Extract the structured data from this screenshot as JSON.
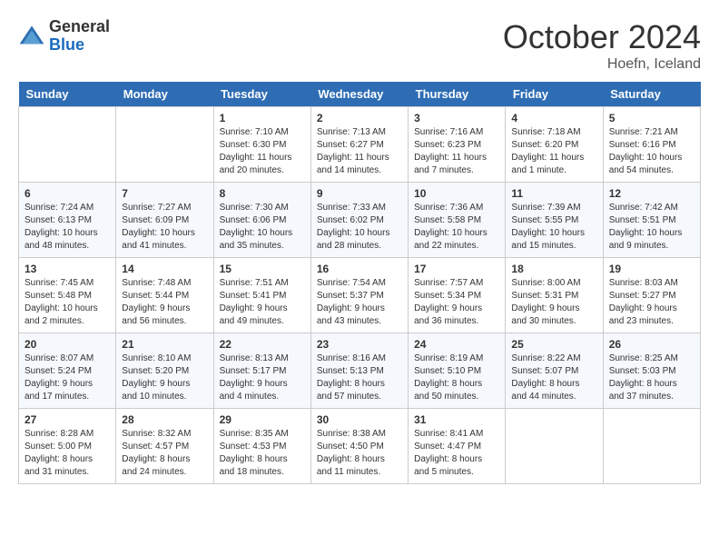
{
  "header": {
    "logo_general": "General",
    "logo_blue": "Blue",
    "month_title": "October 2024",
    "location": "Hoefn, Iceland"
  },
  "days_of_week": [
    "Sunday",
    "Monday",
    "Tuesday",
    "Wednesday",
    "Thursday",
    "Friday",
    "Saturday"
  ],
  "weeks": [
    [
      {
        "day": "",
        "sunrise": "",
        "sunset": "",
        "daylight": ""
      },
      {
        "day": "",
        "sunrise": "",
        "sunset": "",
        "daylight": ""
      },
      {
        "day": "1",
        "sunrise": "Sunrise: 7:10 AM",
        "sunset": "Sunset: 6:30 PM",
        "daylight": "Daylight: 11 hours and 20 minutes."
      },
      {
        "day": "2",
        "sunrise": "Sunrise: 7:13 AM",
        "sunset": "Sunset: 6:27 PM",
        "daylight": "Daylight: 11 hours and 14 minutes."
      },
      {
        "day": "3",
        "sunrise": "Sunrise: 7:16 AM",
        "sunset": "Sunset: 6:23 PM",
        "daylight": "Daylight: 11 hours and 7 minutes."
      },
      {
        "day": "4",
        "sunrise": "Sunrise: 7:18 AM",
        "sunset": "Sunset: 6:20 PM",
        "daylight": "Daylight: 11 hours and 1 minute."
      },
      {
        "day": "5",
        "sunrise": "Sunrise: 7:21 AM",
        "sunset": "Sunset: 6:16 PM",
        "daylight": "Daylight: 10 hours and 54 minutes."
      }
    ],
    [
      {
        "day": "6",
        "sunrise": "Sunrise: 7:24 AM",
        "sunset": "Sunset: 6:13 PM",
        "daylight": "Daylight: 10 hours and 48 minutes."
      },
      {
        "day": "7",
        "sunrise": "Sunrise: 7:27 AM",
        "sunset": "Sunset: 6:09 PM",
        "daylight": "Daylight: 10 hours and 41 minutes."
      },
      {
        "day": "8",
        "sunrise": "Sunrise: 7:30 AM",
        "sunset": "Sunset: 6:06 PM",
        "daylight": "Daylight: 10 hours and 35 minutes."
      },
      {
        "day": "9",
        "sunrise": "Sunrise: 7:33 AM",
        "sunset": "Sunset: 6:02 PM",
        "daylight": "Daylight: 10 hours and 28 minutes."
      },
      {
        "day": "10",
        "sunrise": "Sunrise: 7:36 AM",
        "sunset": "Sunset: 5:58 PM",
        "daylight": "Daylight: 10 hours and 22 minutes."
      },
      {
        "day": "11",
        "sunrise": "Sunrise: 7:39 AM",
        "sunset": "Sunset: 5:55 PM",
        "daylight": "Daylight: 10 hours and 15 minutes."
      },
      {
        "day": "12",
        "sunrise": "Sunrise: 7:42 AM",
        "sunset": "Sunset: 5:51 PM",
        "daylight": "Daylight: 10 hours and 9 minutes."
      }
    ],
    [
      {
        "day": "13",
        "sunrise": "Sunrise: 7:45 AM",
        "sunset": "Sunset: 5:48 PM",
        "daylight": "Daylight: 10 hours and 2 minutes."
      },
      {
        "day": "14",
        "sunrise": "Sunrise: 7:48 AM",
        "sunset": "Sunset: 5:44 PM",
        "daylight": "Daylight: 9 hours and 56 minutes."
      },
      {
        "day": "15",
        "sunrise": "Sunrise: 7:51 AM",
        "sunset": "Sunset: 5:41 PM",
        "daylight": "Daylight: 9 hours and 49 minutes."
      },
      {
        "day": "16",
        "sunrise": "Sunrise: 7:54 AM",
        "sunset": "Sunset: 5:37 PM",
        "daylight": "Daylight: 9 hours and 43 minutes."
      },
      {
        "day": "17",
        "sunrise": "Sunrise: 7:57 AM",
        "sunset": "Sunset: 5:34 PM",
        "daylight": "Daylight: 9 hours and 36 minutes."
      },
      {
        "day": "18",
        "sunrise": "Sunrise: 8:00 AM",
        "sunset": "Sunset: 5:31 PM",
        "daylight": "Daylight: 9 hours and 30 minutes."
      },
      {
        "day": "19",
        "sunrise": "Sunrise: 8:03 AM",
        "sunset": "Sunset: 5:27 PM",
        "daylight": "Daylight: 9 hours and 23 minutes."
      }
    ],
    [
      {
        "day": "20",
        "sunrise": "Sunrise: 8:07 AM",
        "sunset": "Sunset: 5:24 PM",
        "daylight": "Daylight: 9 hours and 17 minutes."
      },
      {
        "day": "21",
        "sunrise": "Sunrise: 8:10 AM",
        "sunset": "Sunset: 5:20 PM",
        "daylight": "Daylight: 9 hours and 10 minutes."
      },
      {
        "day": "22",
        "sunrise": "Sunrise: 8:13 AM",
        "sunset": "Sunset: 5:17 PM",
        "daylight": "Daylight: 9 hours and 4 minutes."
      },
      {
        "day": "23",
        "sunrise": "Sunrise: 8:16 AM",
        "sunset": "Sunset: 5:13 PM",
        "daylight": "Daylight: 8 hours and 57 minutes."
      },
      {
        "day": "24",
        "sunrise": "Sunrise: 8:19 AM",
        "sunset": "Sunset: 5:10 PM",
        "daylight": "Daylight: 8 hours and 50 minutes."
      },
      {
        "day": "25",
        "sunrise": "Sunrise: 8:22 AM",
        "sunset": "Sunset: 5:07 PM",
        "daylight": "Daylight: 8 hours and 44 minutes."
      },
      {
        "day": "26",
        "sunrise": "Sunrise: 8:25 AM",
        "sunset": "Sunset: 5:03 PM",
        "daylight": "Daylight: 8 hours and 37 minutes."
      }
    ],
    [
      {
        "day": "27",
        "sunrise": "Sunrise: 8:28 AM",
        "sunset": "Sunset: 5:00 PM",
        "daylight": "Daylight: 8 hours and 31 minutes."
      },
      {
        "day": "28",
        "sunrise": "Sunrise: 8:32 AM",
        "sunset": "Sunset: 4:57 PM",
        "daylight": "Daylight: 8 hours and 24 minutes."
      },
      {
        "day": "29",
        "sunrise": "Sunrise: 8:35 AM",
        "sunset": "Sunset: 4:53 PM",
        "daylight": "Daylight: 8 hours and 18 minutes."
      },
      {
        "day": "30",
        "sunrise": "Sunrise: 8:38 AM",
        "sunset": "Sunset: 4:50 PM",
        "daylight": "Daylight: 8 hours and 11 minutes."
      },
      {
        "day": "31",
        "sunrise": "Sunrise: 8:41 AM",
        "sunset": "Sunset: 4:47 PM",
        "daylight": "Daylight: 8 hours and 5 minutes."
      },
      {
        "day": "",
        "sunrise": "",
        "sunset": "",
        "daylight": ""
      },
      {
        "day": "",
        "sunrise": "",
        "sunset": "",
        "daylight": ""
      }
    ]
  ]
}
